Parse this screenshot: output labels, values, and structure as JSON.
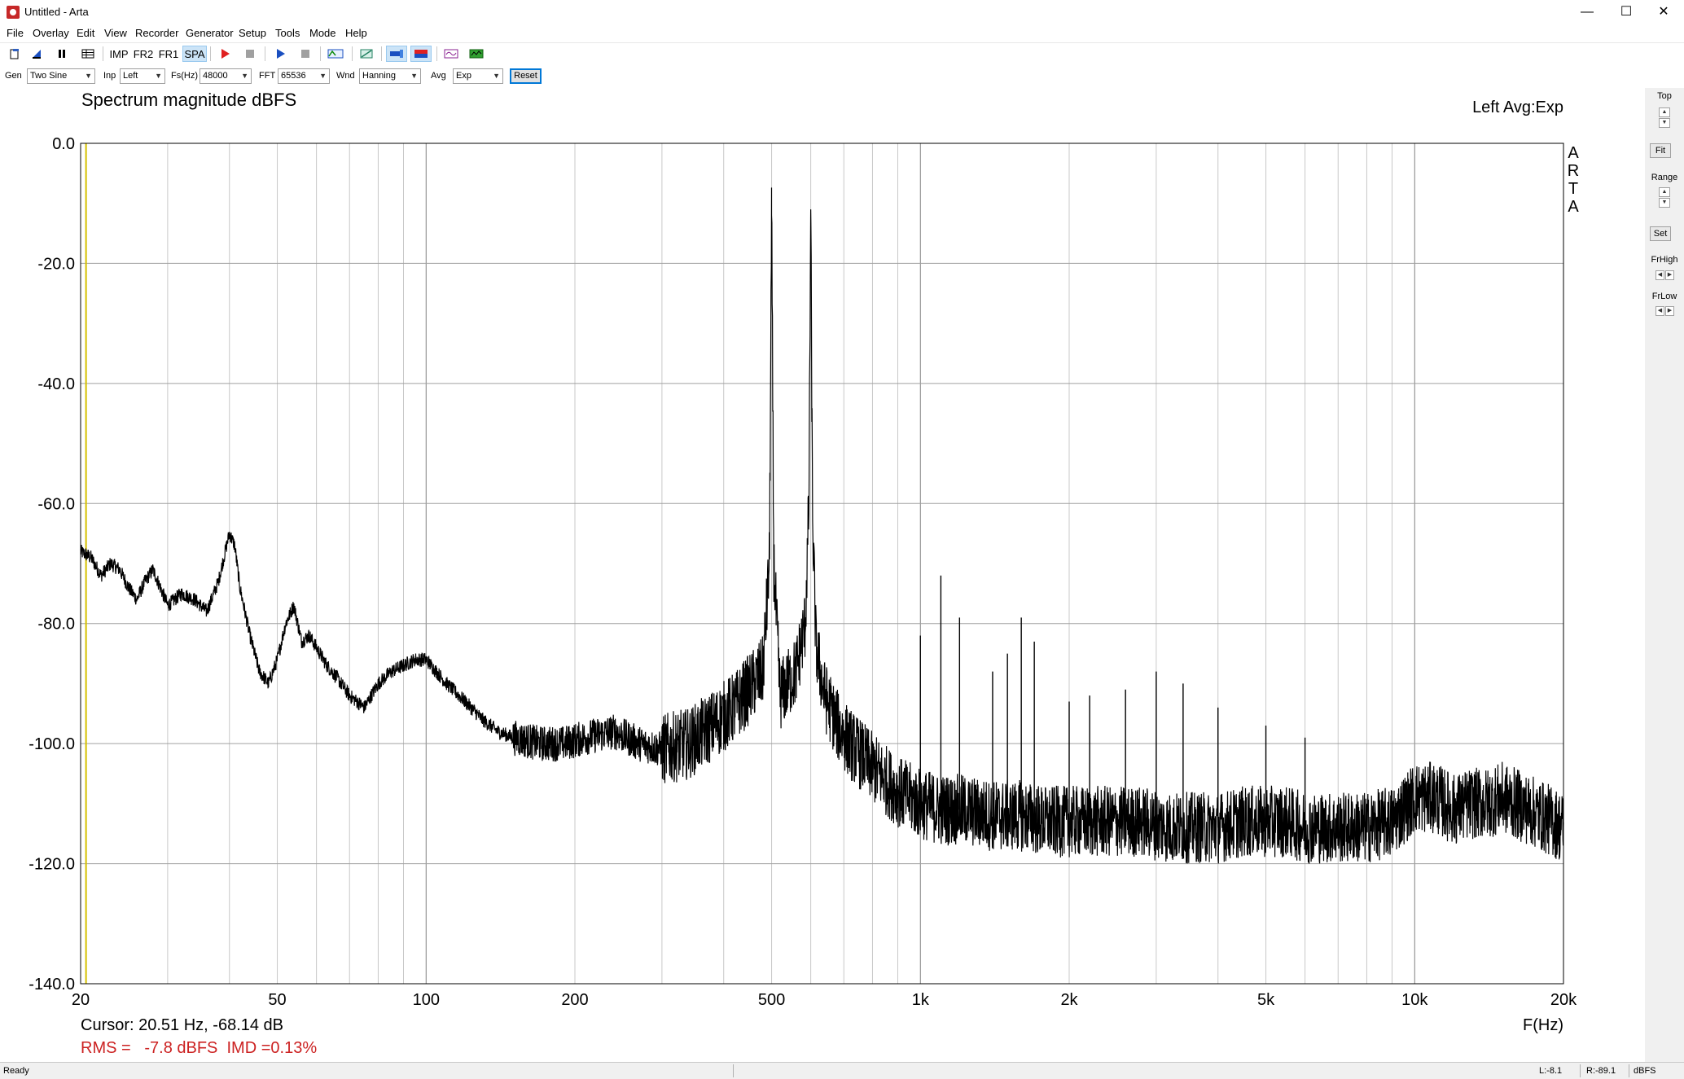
{
  "window": {
    "title": "Untitled - Arta",
    "minimize": "—",
    "maximize": "☐",
    "close": "✕"
  },
  "menu": [
    "File",
    "Overlay",
    "Edit",
    "View",
    "Recorder",
    "Generator",
    "Setup",
    "Tools",
    "Mode",
    "Help"
  ],
  "toolbar": {
    "imp": "IMP",
    "fr2": "FR2",
    "fr1": "FR1",
    "spa": "SPA"
  },
  "controls": {
    "gen_label": "Gen",
    "gen_value": "Two Sine",
    "inp_label": "Inp",
    "inp_value": "Left",
    "fs_label": "Fs(Hz)",
    "fs_value": "48000",
    "fft_label": "FFT",
    "fft_value": "65536",
    "wnd_label": "Wnd",
    "wnd_value": "Hanning",
    "avg_label": "Avg",
    "avg_value": "Exp",
    "reset_label": "Reset"
  },
  "side_panel": {
    "top": "Top",
    "fit": "Fit",
    "range": "Range",
    "set": "Set",
    "frhigh": "FrHigh",
    "frlow": "FrLow"
  },
  "plot": {
    "cursor_text": "Cursor: 20.51 Hz, -68.14 dB",
    "rms_text": "RMS =   -7.8 dBFS  IMD =0.13%",
    "rms_color": "#cc2222",
    "watermark": [
      "A",
      "R",
      "T",
      "A"
    ]
  },
  "chart_data": {
    "type": "line",
    "title": "Spectrum magnitude dBFS",
    "legend": "Left   Avg:Exp",
    "xlabel": "F(Hz)",
    "ylabel": "",
    "xscale": "log",
    "xlim": [
      20,
      20000
    ],
    "ylim": [
      -140,
      0
    ],
    "grid": true,
    "x_ticks": [
      20,
      50,
      100,
      200,
      500,
      1000,
      2000,
      5000,
      10000,
      20000
    ],
    "x_tick_labels": [
      "20",
      "50",
      "100",
      "200",
      "500",
      "1k",
      "2k",
      "5k",
      "10k",
      "20k"
    ],
    "y_ticks": [
      0,
      -20,
      -40,
      -60,
      -80,
      -100,
      -120,
      -140
    ],
    "y_tick_labels": [
      "0.0",
      "-20.0",
      "-40.0",
      "-60.0",
      "-80.0",
      "-100.0",
      "-120.0",
      "-140.0"
    ],
    "line_color": "#000000",
    "cursor_line_color": "#d4c000",
    "cursor_x": 20.51,
    "series": [
      {
        "x": [
          20,
          21,
          22,
          23,
          24,
          25,
          26,
          27,
          28,
          29,
          30,
          32,
          34,
          36,
          38,
          40,
          41,
          42,
          44,
          46,
          48,
          50,
          52,
          54,
          56,
          58,
          60,
          63,
          66,
          70,
          75,
          80,
          85,
          90,
          95,
          100,
          110,
          120,
          130,
          140,
          150,
          170,
          190,
          210,
          240,
          270,
          300,
          340,
          380,
          420,
          460,
          480,
          495,
          500,
          505,
          520,
          560,
          585,
          595,
          600,
          605,
          615,
          640,
          680,
          720,
          760,
          800,
          850,
          900,
          950,
          1000,
          1100,
          1200,
          1400,
          1600,
          1800,
          2000,
          2400,
          2800,
          3200,
          3600,
          4000,
          4500,
          5000,
          5500,
          6000,
          6500,
          7000,
          8000,
          9000,
          10000,
          11000,
          12000,
          13000,
          14000,
          15000,
          16000,
          17000,
          18000,
          19000,
          20000
        ],
        "y": [
          -68,
          -69,
          -72,
          -70,
          -71,
          -74,
          -76,
          -73,
          -71,
          -74,
          -77,
          -75,
          -76,
          -78,
          -73,
          -65,
          -67,
          -74,
          -82,
          -88,
          -90,
          -86,
          -80,
          -77,
          -83,
          -82,
          -84,
          -87,
          -89,
          -92,
          -94,
          -90,
          -88,
          -87,
          -86,
          -86,
          -90,
          -93,
          -96,
          -98,
          -99,
          -100,
          -100,
          -99,
          -98,
          -100,
          -101,
          -100,
          -97,
          -94,
          -90,
          -88,
          -70,
          -12,
          -70,
          -92,
          -88,
          -80,
          -60,
          -11,
          -62,
          -84,
          -92,
          -97,
          -100,
          -102,
          -104,
          -106,
          -108,
          -109,
          -110,
          -111,
          -111,
          -112,
          -112,
          -113,
          -113,
          -113,
          -113,
          -114,
          -114,
          -114,
          -113,
          -113,
          -113,
          -114,
          -114,
          -114,
          -114,
          -113,
          -109,
          -109,
          -111,
          -110,
          -110,
          -109,
          -110,
          -111,
          -112,
          -113,
          -114
        ]
      }
    ],
    "spikes": [
      {
        "x": 1000,
        "y": -82
      },
      {
        "x": 1100,
        "y": -72
      },
      {
        "x": 1200,
        "y": -79
      },
      {
        "x": 1400,
        "y": -88
      },
      {
        "x": 1500,
        "y": -85
      },
      {
        "x": 1600,
        "y": -79
      },
      {
        "x": 1700,
        "y": -83
      },
      {
        "x": 2000,
        "y": -93
      },
      {
        "x": 2200,
        "y": -92
      },
      {
        "x": 2600,
        "y": -91
      },
      {
        "x": 3000,
        "y": -88
      },
      {
        "x": 3400,
        "y": -90
      },
      {
        "x": 4000,
        "y": -94
      },
      {
        "x": 5000,
        "y": -97
      },
      {
        "x": 6000,
        "y": -99
      }
    ]
  }
}
